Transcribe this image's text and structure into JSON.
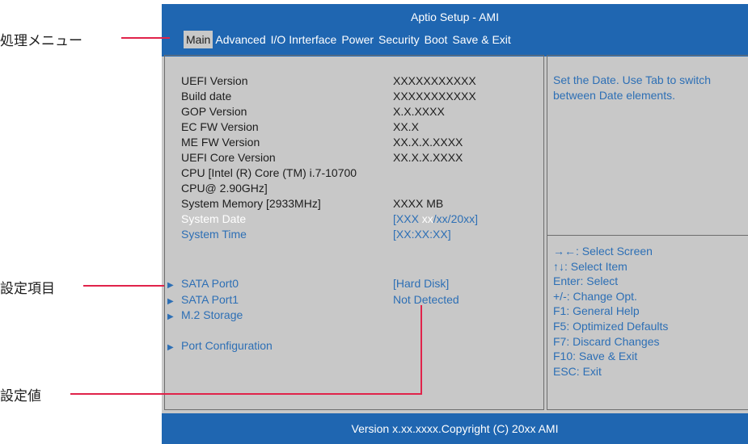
{
  "window": {
    "title": "Aptio Setup - AMI"
  },
  "menu": {
    "items": [
      "Main",
      "Advanced",
      "I/O Inrterface",
      "Power",
      "Security",
      "Boot",
      "Save & Exit"
    ],
    "active": "Main"
  },
  "info_rows": [
    {
      "label": "UEFI Version",
      "value": "XXXXXXXXXXX"
    },
    {
      "label": "Build date",
      "value": "XXXXXXXXXXX"
    },
    {
      "label": "GOP Version",
      "value": "X.X.XXXX"
    },
    {
      "label": "EC FW Version",
      "value": "XX.X"
    },
    {
      "label": "ME FW Version",
      "value": "XX.X.X.XXXX"
    },
    {
      "label": "UEFI Core Version",
      "value": "XX.X.X.XXXX"
    },
    {
      "label": "CPU [Intel (R) Core (TM) i.7-10700",
      "value": ""
    },
    {
      "label": "CPU@ 2.90GHz]",
      "value": ""
    },
    {
      "label": "System Memory [2933MHz]",
      "value": "XXXX MB"
    }
  ],
  "system_date": {
    "label": "System Date",
    "value_prefix": "[XXX ",
    "value_highlight": "xx",
    "value_suffix": "/xx/20xx]"
  },
  "system_time": {
    "label": "System Time",
    "value": "[XX:XX:XX]"
  },
  "submenus": [
    {
      "label": "SATA Port0",
      "value": "[Hard Disk]"
    },
    {
      "label": "SATA Port1",
      "value": "Not Detected"
    },
    {
      "label": "M.2 Storage",
      "value": ""
    }
  ],
  "port_config": {
    "label": "Port  Configuration"
  },
  "help": {
    "text": "Set the Date. Use Tab to switch between Date elements."
  },
  "keys": [
    "→←: Select Screen",
    "↑↓: Select Item",
    "Enter: Select",
    "+/-: Change Opt.",
    "F1: General Help",
    "F5: Optimized Defaults",
    "F7: Discard Changes",
    "F10: Save & Exit",
    "ESC: Exit"
  ],
  "footer": {
    "text": "Version x.xx.xxxx.Copyright (C) 20xx AMI"
  },
  "callouts": {
    "menu": "処理メニュー",
    "items": "設定項目",
    "values": "設定値"
  },
  "colors": {
    "header_blue": "#1f66b1",
    "panel_gray": "#c8c8c8",
    "link_blue": "#2d6fb5",
    "callout_red": "#e0234a"
  }
}
